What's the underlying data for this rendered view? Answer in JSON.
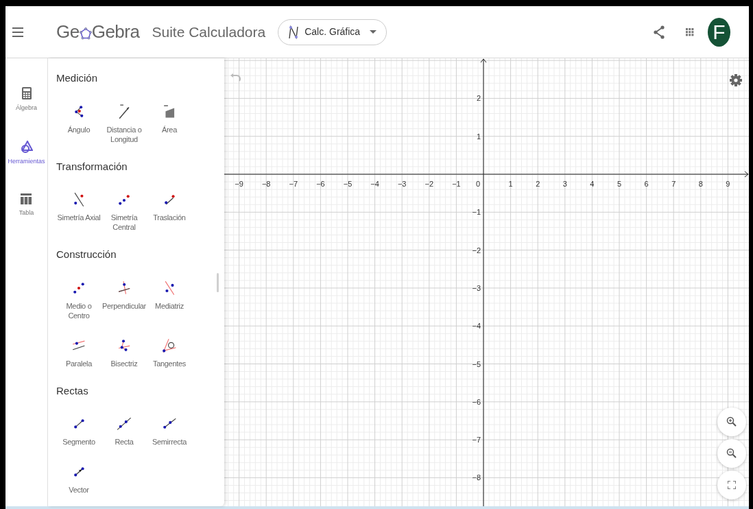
{
  "header": {
    "logo_parts": [
      "Ge",
      "Gebra"
    ],
    "app_title": "Suite Calculadora",
    "app_switcher": {
      "label": "Calc. Gráfica"
    },
    "avatar": "F"
  },
  "rail": [
    {
      "label": "Álgebra",
      "kind": "calculator",
      "selected": false
    },
    {
      "label": "Herramientas",
      "kind": "tools",
      "selected": true
    },
    {
      "label": "Tabla",
      "kind": "table",
      "selected": false
    }
  ],
  "tool_sections": [
    {
      "title": "Medición",
      "tools": [
        {
          "label": "Ángulo",
          "kind": "angle"
        },
        {
          "label": "Distancia o Longitud",
          "kind": "distance"
        },
        {
          "label": "Área",
          "kind": "area"
        }
      ]
    },
    {
      "title": "Transformación",
      "tools": [
        {
          "label": "Simetría Axial",
          "kind": "reflect_line"
        },
        {
          "label": "Simetría Central",
          "kind": "reflect_point"
        },
        {
          "label": "Traslación",
          "kind": "translate"
        }
      ]
    },
    {
      "title": "Construcción",
      "tools": [
        {
          "label": "Medio o Centro",
          "kind": "midpoint"
        },
        {
          "label": "Perpendicular",
          "kind": "perpendicular"
        },
        {
          "label": "Mediatriz",
          "kind": "bisector_line"
        },
        {
          "label": "Paralela",
          "kind": "parallel"
        },
        {
          "label": "Bisectriz",
          "kind": "angle_bisector"
        },
        {
          "label": "Tangentes",
          "kind": "tangents"
        }
      ]
    },
    {
      "title": "Rectas",
      "tools": [
        {
          "label": "Segmento",
          "kind": "segment"
        },
        {
          "label": "Recta",
          "kind": "line"
        },
        {
          "label": "Semirrecta",
          "kind": "ray"
        },
        {
          "label": "Vector",
          "kind": "vector"
        }
      ]
    }
  ],
  "graph": {
    "x_labels_negative": [
      "−9",
      "−8",
      "−7",
      "−6",
      "−5",
      "−4",
      "−3",
      "−2",
      "−1"
    ],
    "origin_label": "0",
    "x_labels_positive": [
      "1",
      "2",
      "3",
      "4",
      "5",
      "6",
      "7",
      "8",
      "9"
    ],
    "y_labels_positive": [
      "2",
      "1"
    ],
    "y_labels_negative": [
      "−1",
      "−2",
      "−3",
      "−4",
      "−5",
      "−6",
      "−7",
      "−8"
    ]
  }
}
